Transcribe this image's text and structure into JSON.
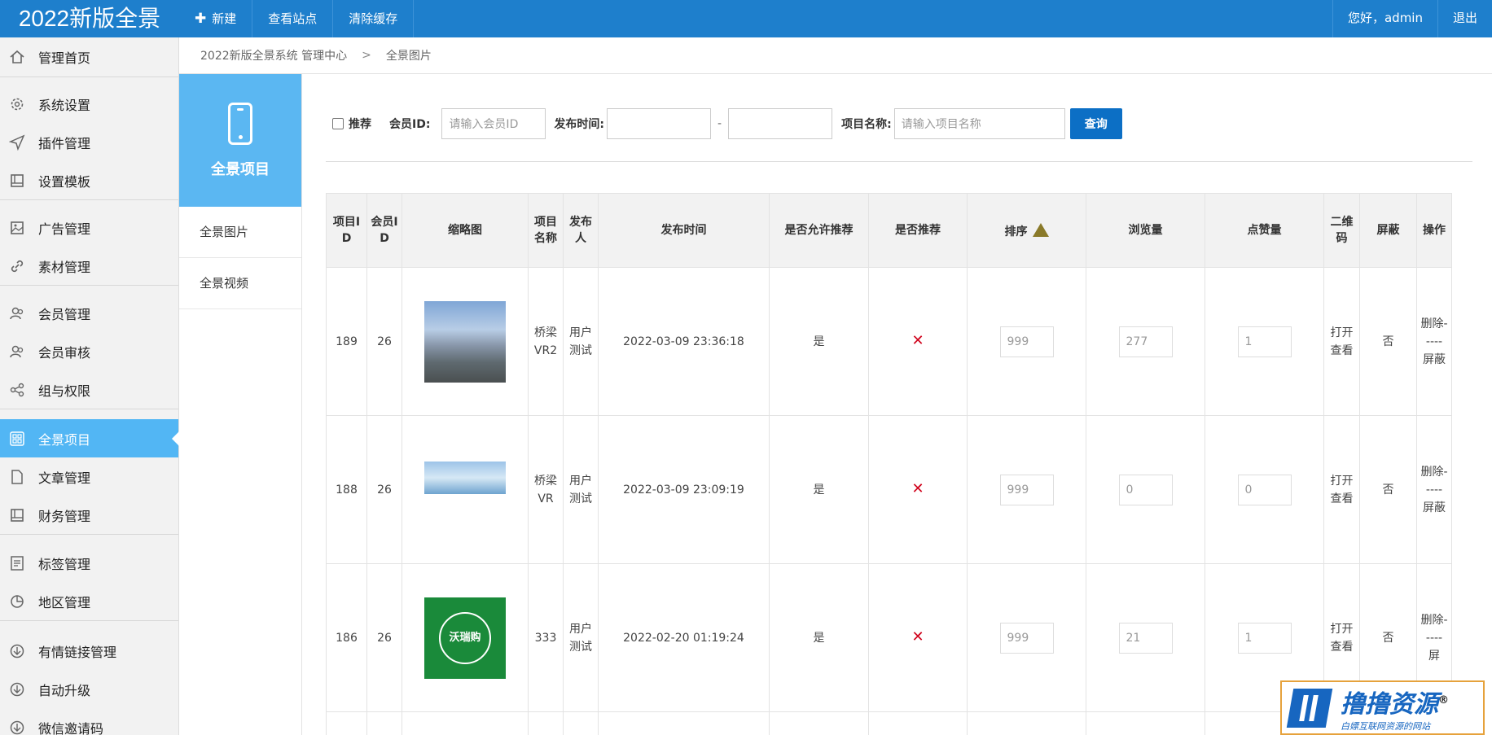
{
  "brand": "2022新版全景",
  "topnav": [
    {
      "label": "新建"
    },
    {
      "label": "查看站点"
    },
    {
      "label": "清除缓存"
    }
  ],
  "user": {
    "greeting": "您好，admin",
    "logout": "退出"
  },
  "sidebar": {
    "items": [
      {
        "label": "管理首页",
        "icon": "home-icon"
      },
      {
        "label": "系统设置",
        "icon": "gear-icon"
      },
      {
        "label": "插件管理",
        "icon": "send-icon"
      },
      {
        "label": "设置模板",
        "icon": "book-icon"
      },
      {
        "label": "广告管理",
        "icon": "image-icon"
      },
      {
        "label": "素材管理",
        "icon": "link-icon"
      },
      {
        "label": "会员管理",
        "icon": "users-icon"
      },
      {
        "label": "会员审核",
        "icon": "users-icon"
      },
      {
        "label": "组与权限",
        "icon": "share-icon"
      },
      {
        "label": "全景项目",
        "icon": "grid-icon",
        "active": true
      },
      {
        "label": "文章管理",
        "icon": "file-icon"
      },
      {
        "label": "财务管理",
        "icon": "book-icon"
      },
      {
        "label": "标签管理",
        "icon": "list-icon"
      },
      {
        "label": "地区管理",
        "icon": "pie-icon"
      },
      {
        "label": "有情链接管理",
        "icon": "download-icon"
      },
      {
        "label": "自动升级",
        "icon": "download-icon"
      },
      {
        "label": "微信邀请码",
        "icon": "download-icon"
      }
    ]
  },
  "breadcrumb": {
    "root": "2022新版全景系统 管理中心",
    "sep": ">",
    "current": "全景图片"
  },
  "submenu": {
    "title": "全景项目",
    "items": [
      {
        "label": "全景图片"
      },
      {
        "label": "全景视频"
      }
    ]
  },
  "search": {
    "recommend_label": "推荐",
    "member_label": "会员ID:",
    "member_placeholder": "请输入会员ID",
    "time_label": "发布时间:",
    "range_sep": "-",
    "name_label": "项目名称:",
    "name_placeholder": "请输入项目名称",
    "query_button": "查询"
  },
  "table": {
    "headers": [
      "项目ID",
      "会员ID",
      "缩略图",
      "项目名称",
      "发布人",
      "发布时间",
      "是否允许推荐",
      "是否推荐",
      "排序",
      "浏览量",
      "点赞量",
      "二维码",
      "屏蔽",
      "操作"
    ],
    "rows": [
      {
        "id": "189",
        "member": "26",
        "thumb": "city-river-thumb",
        "name": "桥梁VR2",
        "publisher": "用户测试",
        "time": "2022-03-09 23:36:18",
        "allow": "是",
        "recommend": "✕",
        "sort": "999",
        "views": "277",
        "likes": "1",
        "qr": "打开查看",
        "block": "否",
        "ops": "删除-----屏蔽"
      },
      {
        "id": "188",
        "member": "26",
        "thumb": "sky-thumb",
        "name": "桥梁VR",
        "publisher": "用户测试",
        "time": "2022-03-09 23:09:19",
        "allow": "是",
        "recommend": "✕",
        "sort": "999",
        "views": "0",
        "likes": "0",
        "qr": "打开查看",
        "block": "否",
        "ops": "删除-----屏蔽"
      },
      {
        "id": "186",
        "member": "26",
        "thumb": "logo-thumb",
        "thumb_text": "沃瑞购",
        "name": "333",
        "publisher": "用户测试",
        "time": "2022-02-20 01:19:24",
        "allow": "是",
        "recommend": "✕",
        "sort": "999",
        "views": "21",
        "likes": "1",
        "qr": "打开查看",
        "block": "否",
        "ops": "删除-----屏"
      }
    ]
  },
  "watermark": {
    "title": "撸撸资源",
    "reg": "®",
    "subtitle": "白嫖互联网资源的网站"
  },
  "colors": {
    "topbar": "#1e7fcc",
    "active": "#52b6f4",
    "button": "#0c6fc5",
    "cross": "#d0021b"
  }
}
